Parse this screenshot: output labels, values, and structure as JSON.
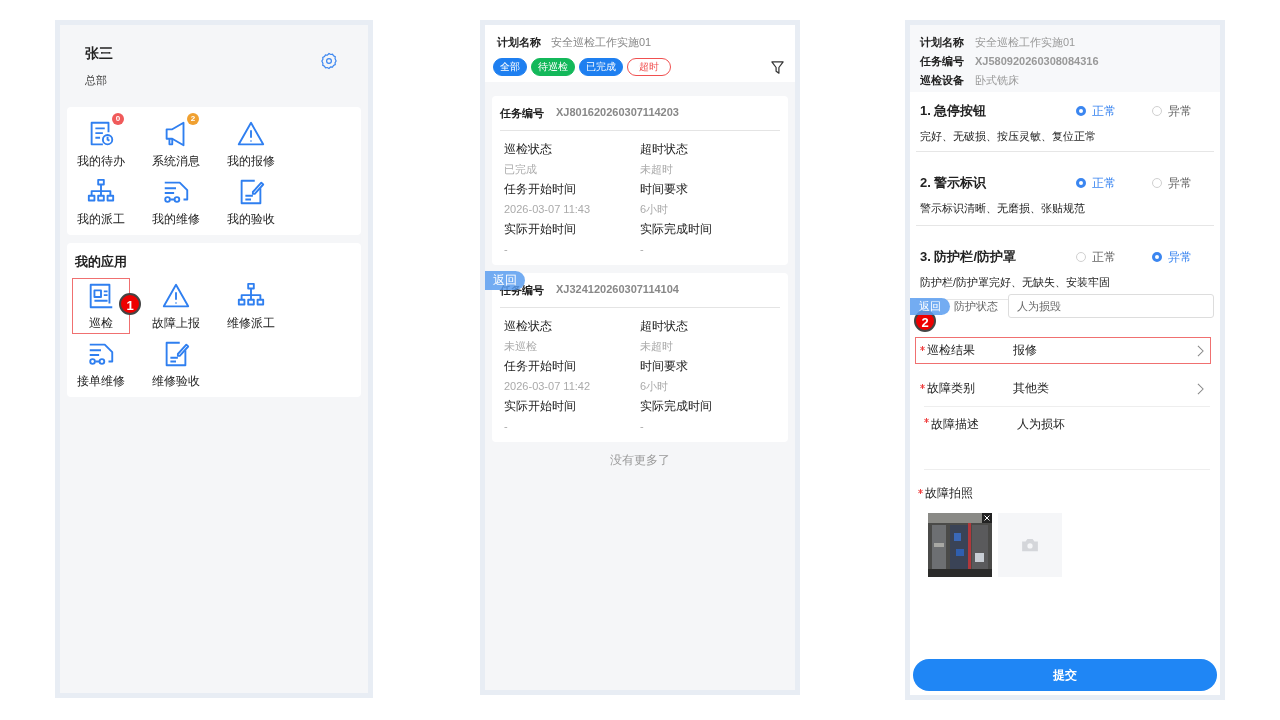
{
  "home": {
    "user": {
      "name": "张三",
      "department": "总部"
    },
    "shortcuts": [
      {
        "label": "我的待办",
        "kind": "todo",
        "badge": "0",
        "color": "#f05a5a"
      },
      {
        "label": "系统消息",
        "kind": "megaphone",
        "badge": "2",
        "color": "#f0a030"
      },
      {
        "label": "我的报修",
        "kind": "warning"
      },
      {
        "label": "我的派工",
        "kind": "org"
      },
      {
        "label": "我的维修",
        "kind": "truck"
      },
      {
        "label": "我的验收",
        "kind": "edit"
      }
    ],
    "apps_title": "我的应用",
    "apps": [
      {
        "label": "巡检",
        "kind": "doc",
        "highlighted": true,
        "step": "1"
      },
      {
        "label": "故障上报",
        "kind": "warning",
        "highlighted": false
      },
      {
        "label": "维修派工",
        "kind": "org",
        "highlighted": false
      },
      {
        "label": "接单维修",
        "kind": "truck",
        "highlighted": false
      },
      {
        "label": "维修验收",
        "kind": "edit",
        "highlighted": false
      }
    ]
  },
  "task_list": {
    "plan_label": "计划名称",
    "plan_name": "安全巡检工作实施01",
    "filters": [
      {
        "label": "全部",
        "kind": "filled",
        "color": "#1e7ff0"
      },
      {
        "label": "待巡检",
        "kind": "filled",
        "color": "#13b85a"
      },
      {
        "label": "已完成",
        "kind": "filled",
        "color": "#1e7ff0"
      },
      {
        "label": "超时",
        "kind": "outlined",
        "color": "#f05050"
      }
    ],
    "tasks": [
      {
        "id_label": "任务编号",
        "id": "XJ801620260307114203",
        "fields": [
          {
            "label": "巡检状态",
            "value": "已完成"
          },
          {
            "label": "超时状态",
            "value": "未超时"
          },
          {
            "label": "任务开始时间",
            "value": "2026-03-07 11:43"
          },
          {
            "label": "时间要求",
            "value": "6小时"
          },
          {
            "label": "实际开始时间",
            "value": "-"
          },
          {
            "label": "实际完成时间",
            "value": "-"
          }
        ]
      },
      {
        "id_label": "任务编号",
        "id": "XJ324120260307114104",
        "fields": [
          {
            "label": "巡检状态",
            "value": "未巡检"
          },
          {
            "label": "超时状态",
            "value": "未超时"
          },
          {
            "label": "任务开始时间",
            "value": "2026-03-07 11:42"
          },
          {
            "label": "时间要求",
            "value": "6小时"
          },
          {
            "label": "实际开始时间",
            "value": "-"
          },
          {
            "label": "实际完成时间",
            "value": "-"
          }
        ]
      }
    ],
    "footer": "没有更多了",
    "back": "返回"
  },
  "form": {
    "info": [
      {
        "label": "计划名称",
        "value": "安全巡检工作实施01"
      },
      {
        "label": "任务编号",
        "value": "XJ580920260308084316"
      },
      {
        "label": "巡检设备",
        "value": "卧式铣床"
      }
    ],
    "items": [
      {
        "title": "1. 急停按钮",
        "description": "完好、无破损、按压灵敏、复位正常",
        "options": [
          {
            "label": "正常",
            "selected": true
          },
          {
            "label": "异常",
            "selected": false
          }
        ]
      },
      {
        "title": "2. 警示标识",
        "description": "警示标识清晰、无磨损、张贴规范",
        "options": [
          {
            "label": "正常",
            "selected": true
          },
          {
            "label": "异常",
            "selected": false
          }
        ]
      },
      {
        "title": "3. 防护栏/防护罩",
        "description": "防护栏/防护罩完好、无缺失、安装牢固",
        "options": [
          {
            "label": "正常",
            "selected": false
          },
          {
            "label": "异常",
            "selected": true
          }
        ]
      }
    ],
    "status_field": {
      "label": "防护状态",
      "value": "人为损毁"
    },
    "rows": [
      {
        "label": "巡检结果",
        "value": "报修",
        "required": true,
        "chevron": true,
        "highlighted": true,
        "step": "2"
      },
      {
        "label": "故障类别",
        "value": "其他类",
        "required": true,
        "chevron": true,
        "highlighted": false
      },
      {
        "label": "故障描述",
        "value": "人为损坏",
        "required": true,
        "chevron": false,
        "highlighted": false
      }
    ],
    "photo_label": "故障拍照",
    "photo_required": true,
    "submit": "提交",
    "back": "返回"
  }
}
